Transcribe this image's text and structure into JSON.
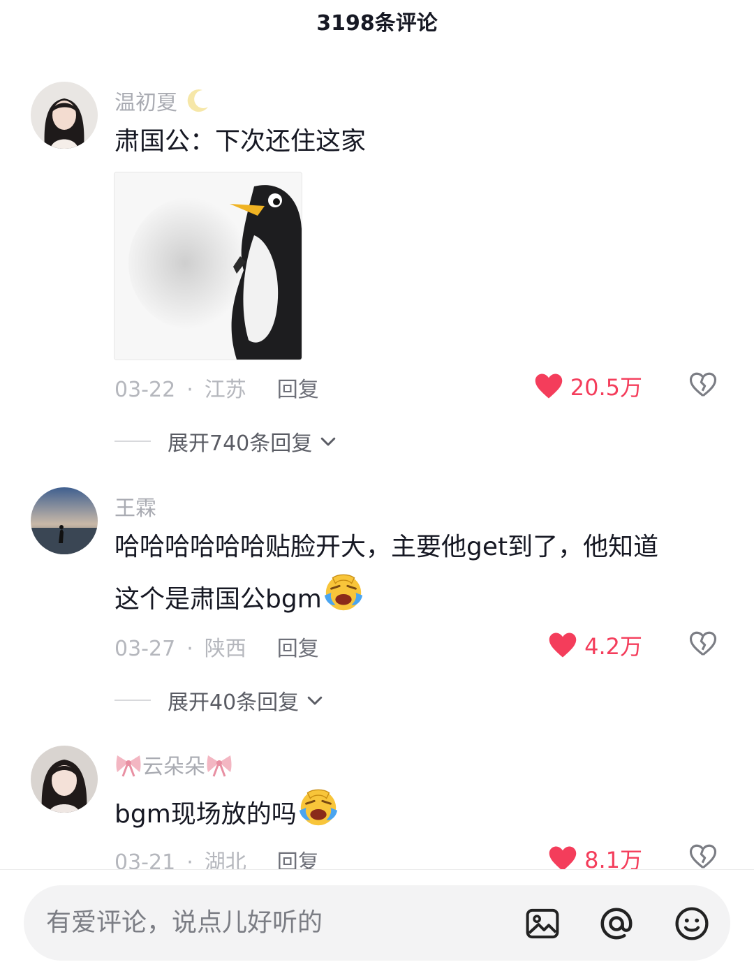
{
  "header": {
    "title": "3198条评论"
  },
  "comments": [
    {
      "username": "温初夏",
      "text": "肃国公：下次还住这家",
      "date": "03-22",
      "location": "江苏",
      "reply_label": "回复",
      "likes": "20.5万",
      "expand_label": "展开740条回复"
    },
    {
      "username": "王霖",
      "text_line1": "哈哈哈哈哈哈贴脸开大，主要他get到了，他知道",
      "text_line2": "这个是肃国公bgm",
      "date": "03-27",
      "location": "陕西",
      "reply_label": "回复",
      "likes": "4.2万",
      "expand_label": "展开40条回复"
    },
    {
      "username": "云朵朵",
      "text": "bgm现场放的吗",
      "date": "03-21",
      "location": "湖北",
      "reply_label": "回复",
      "likes": "8.1万"
    }
  ],
  "composer": {
    "placeholder": "有爱评论，说点儿好听的"
  },
  "icons": {
    "like": "heart-icon",
    "dislike": "broken-heart-icon",
    "expand": "chevron-down-icon",
    "image": "image-icon",
    "mention": "at-icon",
    "emoji": "emoji-icon"
  },
  "colors": {
    "like": "#f43d5b",
    "username": "#a9abb2",
    "text": "#161823"
  }
}
